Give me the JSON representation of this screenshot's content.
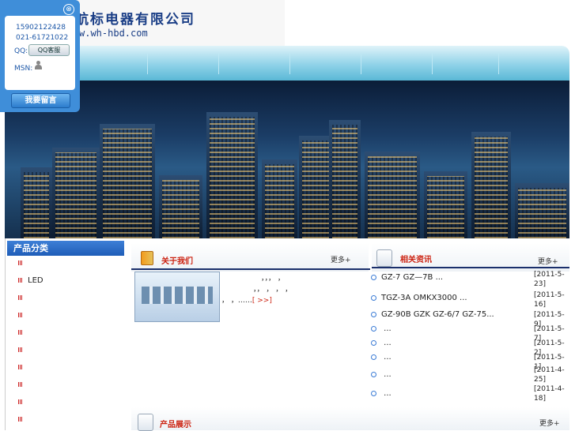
{
  "header": {
    "title": "航标电器有限公司",
    "url": "w.wh-hbd.com"
  },
  "float_panel": {
    "phone1": "15902122428",
    "phone2": "021-61721022",
    "qq_label": "QQ:",
    "qq_button": "QQ客服",
    "msn_label": "MSN:",
    "message_button": "我要留言",
    "close_glyph": "⊗"
  },
  "sidebar": {
    "heading": "产品分类",
    "items": [
      "",
      "LED",
      "",
      "",
      "",
      "",
      "",
      "",
      "",
      ""
    ]
  },
  "about": {
    "title": "关于我们",
    "more": "更多+",
    "text_line1": "，，，        ，",
    "text_line2": "，，    ，  ，    ，",
    "text_line3": "，          ，……",
    "read_more": "[ >>]"
  },
  "news": {
    "title": "相关资讯",
    "more": "更多+",
    "items": [
      {
        "text": "GZ-7 GZ—7B          ...",
        "date": "[2011-5-23]"
      },
      {
        "text": "TGZ-3A  OMKX3000      ...",
        "date": "[2011-5-16]"
      },
      {
        "text": "GZ-90B GZK GZ-6/7 GZ-75...",
        "date": "[2011-5-9]"
      },
      {
        "text": "           ...",
        "date": "[2011-5-7]"
      },
      {
        "text": "           ...",
        "date": "[2011-5-2]"
      },
      {
        "text": "           ...",
        "date": "[2011-5-1]"
      },
      {
        "text": "           ...",
        "date": "[2011-4-25]"
      },
      {
        "text": "           ...",
        "date": "[2011-4-18]"
      }
    ]
  },
  "products": {
    "title": "产品展示",
    "more": "更多+"
  }
}
